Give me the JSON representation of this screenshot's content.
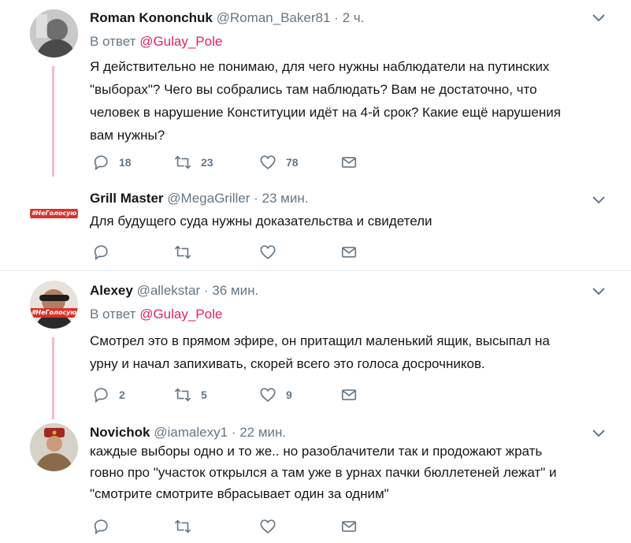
{
  "tweets": [
    {
      "fullname": "Roman Kononchuk",
      "username": "@Roman_Baker81",
      "sep": "·",
      "time": "2 ч.",
      "reply_prefix": "В ответ",
      "reply_to": "@Gulay_Pole",
      "text": "Я действительно не понимаю, для чего нужны наблюдатели на путинских\n\"выборах\"? Чего вы собрались там наблюдать? Вам не достаточно, что\nчеловек в нарушение Конституции идёт на 4-й срок? Какие ещё нарушения\nвам нужны?",
      "replies": "18",
      "retweets": "23",
      "likes": "78"
    },
    {
      "fullname": "Grill Master",
      "username": "@MegaGriller",
      "sep": "·",
      "time": "23 мин.",
      "text": "Для будущего суда нужны доказательства и свидетели",
      "avatar_tag": "#НеГолосую"
    },
    {
      "fullname": "Alexey",
      "username": "@allekstar",
      "sep": "·",
      "time": "36 мин.",
      "reply_prefix": "В ответ",
      "reply_to": "@Gulay_Pole",
      "text": "Смотрел это в прямом эфире, он притащил маленький ящик, высыпал  на\nурну и начал запихивать, скорей всего это голоса досрочников.",
      "replies": "2",
      "retweets": "5",
      "likes": "9",
      "avatar_tag": "#НеГолосую"
    },
    {
      "fullname": "Novichok",
      "username": "@iamalexy1",
      "sep": "·",
      "time": "22 мин.",
      "text": "каждые выборы одно и то же.. но разоблачители так и продожают жрать\nговно про \"участок открылся а там уже в урнах пачки бюллетеней лежат\" и\n\"смотрите смотрите вбрасывает один за одним\""
    }
  ],
  "colors": {
    "accent": "#e0245e",
    "thread_line": "#f5b8d4",
    "muted": "#657786",
    "text": "#14171a",
    "tag_red": "#d9332b"
  },
  "icons": {
    "reply": "reply-icon",
    "retweet": "retweet-icon",
    "like": "heart-icon",
    "dm": "envelope-icon",
    "more": "chevron-down-icon"
  }
}
